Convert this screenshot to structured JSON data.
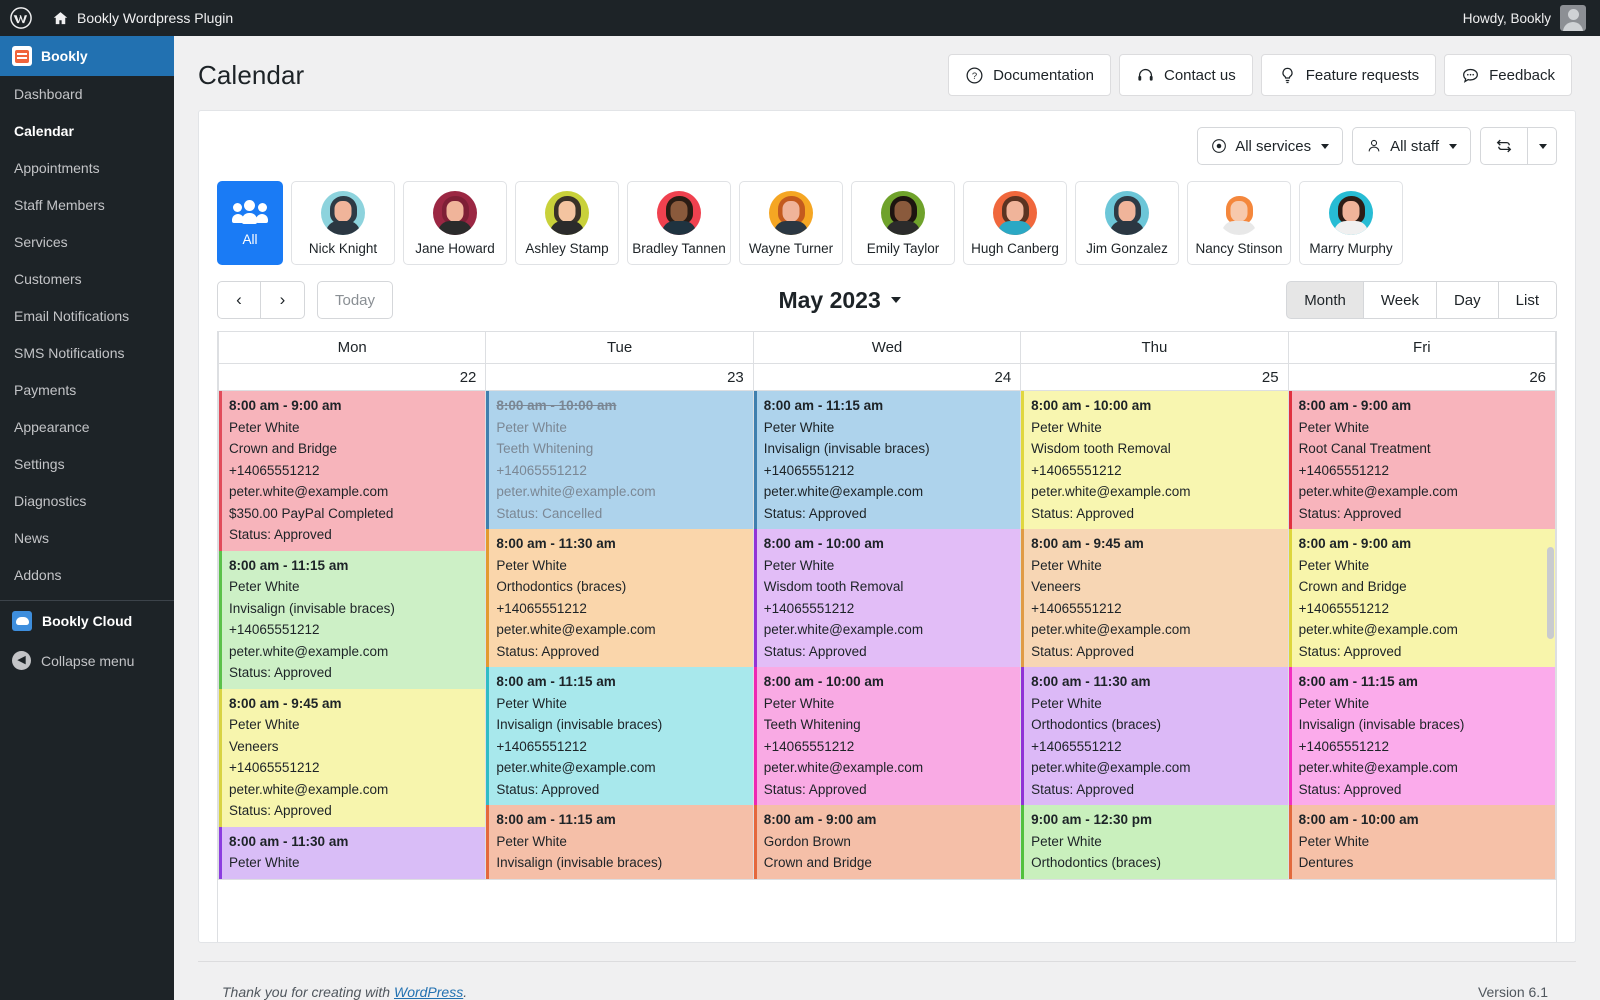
{
  "adminbar": {
    "site_title": "Bookly Wordpress Plugin",
    "howdy": "Howdy, Bookly",
    "wp_logo_icon": "wordpress-logo-icon",
    "home_icon": "home-icon",
    "avatar_icon": "user-avatar-icon"
  },
  "sidebar": {
    "brand": "Bookly",
    "brand_icon": "bookly-logo-icon",
    "items": [
      {
        "label": "Dashboard",
        "current": false
      },
      {
        "label": "Calendar",
        "current": true
      },
      {
        "label": "Appointments",
        "current": false
      },
      {
        "label": "Staff Members",
        "current": false
      },
      {
        "label": "Services",
        "current": false
      },
      {
        "label": "Customers",
        "current": false
      },
      {
        "label": "Email Notifications",
        "current": false
      },
      {
        "label": "SMS Notifications",
        "current": false
      },
      {
        "label": "Payments",
        "current": false
      },
      {
        "label": "Appearance",
        "current": false
      },
      {
        "label": "Settings",
        "current": false
      },
      {
        "label": "Diagnostics",
        "current": false
      },
      {
        "label": "News",
        "current": false
      },
      {
        "label": "Addons",
        "current": false
      }
    ],
    "cloud_label": "Bookly Cloud",
    "cloud_icon": "cloud-icon",
    "collapse_label": "Collapse menu",
    "collapse_icon": "chevron-left-circle-icon"
  },
  "page": {
    "title": "Calendar",
    "header_buttons": [
      {
        "label": "Documentation",
        "icon": "question-circle-icon"
      },
      {
        "label": "Contact us",
        "icon": "headset-icon"
      },
      {
        "label": "Feature requests",
        "icon": "lightbulb-icon"
      },
      {
        "label": "Feedback",
        "icon": "chat-bubble-icon"
      }
    ]
  },
  "filters": {
    "services": {
      "label": "All services",
      "icon": "target-circle-icon"
    },
    "staff": {
      "label": "All staff",
      "icon": "person-icon"
    },
    "refresh_icon": "refresh-icon",
    "refresh_caret_icon": "chevron-down-icon"
  },
  "staff_strip": [
    {
      "label": "All",
      "icon": "group-people-icon",
      "selected": true,
      "bg": "#1a7bf5",
      "hair": "#ffffff",
      "skin": "#ffffff",
      "body": "#ffffff"
    },
    {
      "label": "Nick Knight",
      "selected": false,
      "bg": "#8dd3dd",
      "hair": "#2e3a45",
      "skin": "#f0b49a",
      "body": "#2b3742"
    },
    {
      "label": "Jane Howard",
      "selected": false,
      "bg": "#9b2743",
      "hair": "#7e1f36",
      "skin": "#f0b49a",
      "body": "#2b2b2b"
    },
    {
      "label": "Ashley Stamp",
      "selected": false,
      "bg": "#c9d13a",
      "hair": "#3a3228",
      "skin": "#f4c4a0",
      "body": "#2b2b2b"
    },
    {
      "label": "Bradley Tannen",
      "selected": false,
      "bg": "#f0414f",
      "hair": "#2a1c14",
      "skin": "#8a5a3c",
      "body": "#1f3340"
    },
    {
      "label": "Wayne Turner",
      "selected": false,
      "bg": "#f5a623",
      "hair": "#c35a1e",
      "skin": "#f0b49a",
      "body": "#2b3742"
    },
    {
      "label": "Emily Taylor",
      "selected": false,
      "bg": "#6fa22b",
      "hair": "#1d1410",
      "skin": "#8a5a3c",
      "body": "#2b2b2b"
    },
    {
      "label": "Hugh Canberg",
      "selected": false,
      "bg": "#f0673c",
      "hair": "#5b3321",
      "skin": "#f0b49a",
      "body": "#2ba8c4"
    },
    {
      "label": "Jim Gonzalez",
      "selected": false,
      "bg": "#6cc6d8",
      "hair": "#2e3a45",
      "skin": "#f0b49a",
      "body": "#2b3742"
    },
    {
      "label": "Nancy Stinson",
      "selected": false,
      "bg": "#ffffff",
      "hair": "#f4873c",
      "skin": "#f7c9ac",
      "body": "#e8e8e8"
    },
    {
      "label": "Marry Murphy",
      "selected": false,
      "bg": "#27bcd4",
      "hair": "#2d1d16",
      "skin": "#f0b49a",
      "body": "#f0f0f0"
    }
  ],
  "toolbar": {
    "prev_icon": "chevron-left-icon",
    "next_icon": "chevron-right-icon",
    "today_label": "Today",
    "month_title": "May 2023",
    "month_caret_icon": "chevron-down-icon",
    "views": [
      {
        "label": "Month",
        "active": true
      },
      {
        "label": "Week",
        "active": false
      },
      {
        "label": "Day",
        "active": false
      },
      {
        "label": "List",
        "active": false
      }
    ]
  },
  "calendar": {
    "columns": [
      {
        "day": "Mon",
        "date": "22"
      },
      {
        "day": "Tue",
        "date": "23"
      },
      {
        "day": "Wed",
        "date": "24"
      },
      {
        "day": "Thu",
        "date": "25"
      },
      {
        "day": "Fri",
        "date": "26"
      }
    ],
    "events": [
      [
        {
          "time": "8:00 am - 9:00 am",
          "customer": "Peter White",
          "service": "Crown and Bridge",
          "phone": "+14065551212",
          "email": "peter.white@example.com",
          "payment": "$350.00 PayPal Completed",
          "status": "Status: Approved",
          "bg": "#f7b4bb",
          "bar": "#e14b5a",
          "cancelled": false
        },
        {
          "time": "8:00 am - 11:15 am",
          "customer": "Peter White",
          "service": "Invisalign (invisable braces)",
          "phone": "+14065551212",
          "email": "peter.white@example.com",
          "payment": "",
          "status": "Status: Approved",
          "bg": "#cdf0c6",
          "bar": "#5bc14a",
          "cancelled": false
        },
        {
          "time": "8:00 am - 9:45 am",
          "customer": "Peter White",
          "service": "Veneers",
          "phone": "+14065551212",
          "email": "peter.white@example.com",
          "payment": "",
          "status": "Status: Approved",
          "bg": "#f7f5ad",
          "bar": "#d8d342",
          "cancelled": false
        },
        {
          "time": "8:00 am - 11:30 am",
          "customer": "Peter White",
          "service": "",
          "phone": "",
          "email": "",
          "payment": "",
          "status": "",
          "bg": "#d9bdf7",
          "bar": "#8b3ce0",
          "cancelled": false
        }
      ],
      [
        {
          "time": "8:00 am - 10:00 am",
          "customer": "Peter White",
          "service": "Teeth Whitening",
          "phone": "+14065551212",
          "email": "peter.white@example.com",
          "payment": "",
          "status": "Status: Cancelled",
          "bg": "#aed3ec",
          "bar": "#3f7fae",
          "cancelled": true
        },
        {
          "time": "8:00 am - 11:30 am",
          "customer": "Peter White",
          "service": "Orthodontics (braces)",
          "phone": "+14065551212",
          "email": "peter.white@example.com",
          "payment": "",
          "status": "Status: Approved",
          "bg": "#fad6ab",
          "bar": "#e39a2e",
          "cancelled": false
        },
        {
          "time": "8:00 am - 11:15 am",
          "customer": "Peter White",
          "service": "Invisalign (invisable braces)",
          "phone": "+14065551212",
          "email": "peter.white@example.com",
          "payment": "",
          "status": "Status: Approved",
          "bg": "#a8e8ec",
          "bar": "#2fbcc6",
          "cancelled": false
        },
        {
          "time": "8:00 am - 11:15 am",
          "customer": "Peter White",
          "service": "Invisalign (invisable braces)",
          "phone": "",
          "email": "",
          "payment": "",
          "status": "",
          "bg": "#f5bfa8",
          "bar": "#e4683c",
          "cancelled": false
        }
      ],
      [
        {
          "time": "8:00 am - 11:15 am",
          "customer": "Peter White",
          "service": "Invisalign (invisable braces)",
          "phone": "+14065551212",
          "email": "peter.white@example.com",
          "payment": "",
          "status": "Status: Approved",
          "bg": "#aed3ec",
          "bar": "#3f7fae",
          "cancelled": false
        },
        {
          "time": "8:00 am - 10:00 am",
          "customer": "Peter White",
          "service": "Wisdom tooth Removal",
          "phone": "+14065551212",
          "email": "peter.white@example.com",
          "payment": "",
          "status": "Status: Approved",
          "bg": "#e2bdf7",
          "bar": "#9333d6",
          "cancelled": false
        },
        {
          "time": "8:00 am - 10:00 am",
          "customer": "Peter White",
          "service": "Teeth Whitening",
          "phone": "+14065551212",
          "email": "peter.white@example.com",
          "payment": "",
          "status": "Status: Approved",
          "bg": "#f9aae4",
          "bar": "#ee28b4",
          "cancelled": false
        },
        {
          "time": "8:00 am - 9:00 am",
          "customer": "Gordon Brown",
          "service": "Crown and Bridge",
          "phone": "",
          "email": "",
          "payment": "",
          "status": "",
          "bg": "#f5bfa8",
          "bar": "#e4683c",
          "cancelled": false
        }
      ],
      [
        {
          "time": "8:00 am - 10:00 am",
          "customer": "Peter White",
          "service": "Wisdom tooth Removal",
          "phone": "+14065551212",
          "email": "peter.white@example.com",
          "payment": "",
          "status": "Status: Approved",
          "bg": "#f8f6b0",
          "bar": "#e0d73f",
          "cancelled": false
        },
        {
          "time": "8:00 am - 9:45 am",
          "customer": "Peter White",
          "service": "Veneers",
          "phone": "+14065551212",
          "email": "peter.white@example.com",
          "payment": "",
          "status": "Status: Approved",
          "bg": "#f7d6b4",
          "bar": "#e09b45",
          "cancelled": false
        },
        {
          "time": "8:00 am - 11:30 am",
          "customer": "Peter White",
          "service": "Orthodontics (braces)",
          "phone": "+14065551212",
          "email": "peter.white@example.com",
          "payment": "",
          "status": "Status: Approved",
          "bg": "#dcb9f7",
          "bar": "#8f33d6",
          "cancelled": false
        },
        {
          "time": "9:00 am - 12:30 pm",
          "customer": "Peter White",
          "service": "Orthodontics (braces)",
          "phone": "",
          "email": "",
          "payment": "",
          "status": "",
          "bg": "#c9f0bd",
          "bar": "#52c13d",
          "cancelled": false
        }
      ],
      [
        {
          "time": "8:00 am - 9:00 am",
          "customer": "Peter White",
          "service": "Root Canal Treatment",
          "phone": "+14065551212",
          "email": "peter.white@example.com",
          "payment": "",
          "status": "Status: Approved",
          "bg": "#f8b4bc",
          "bar": "#e0313f",
          "cancelled": false
        },
        {
          "time": "8:00 am - 9:00 am",
          "customer": "Peter White",
          "service": "Crown and Bridge",
          "phone": "+14065551212",
          "email": "peter.white@example.com",
          "payment": "",
          "status": "Status: Approved",
          "bg": "#f8f5ab",
          "bar": "#ddd63c",
          "cancelled": false
        },
        {
          "time": "8:00 am - 11:15 am",
          "customer": "Peter White",
          "service": "Invisalign (invisable braces)",
          "phone": "+14065551212",
          "email": "peter.white@example.com",
          "payment": "",
          "status": "Status: Approved",
          "bg": "#fbabeb",
          "bar": "#f22ec0",
          "cancelled": false
        },
        {
          "time": "8:00 am - 10:00 am",
          "customer": "Peter White",
          "service": "Dentures",
          "phone": "",
          "email": "",
          "payment": "",
          "status": "",
          "bg": "#f6c1a8",
          "bar": "#e2693c",
          "cancelled": false
        }
      ]
    ]
  },
  "footer": {
    "thanks_prefix": "Thank you for creating with ",
    "wordpress_link": "WordPress",
    "thanks_suffix": ".",
    "version": "Version 6.1"
  }
}
